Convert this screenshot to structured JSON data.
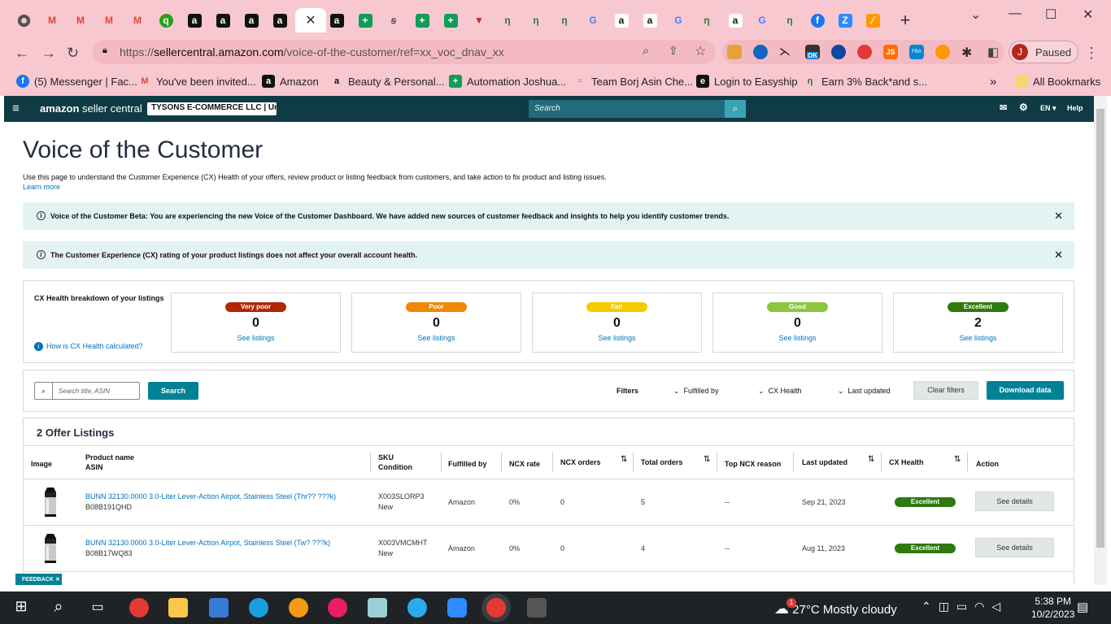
{
  "browser": {
    "url_prefix": "https://",
    "url_domain": "sellercentral.amazon.com",
    "url_path": "/voice-of-the-customer/ref=xx_voc_dnav_xx",
    "profile_initial": "J",
    "profile_status": "Paused",
    "ext_badge": "OK",
    "ext_js": "JS",
    "ext_fba": "FBA",
    "bookmarks": [
      {
        "label": "(5) Messenger | Fac...",
        "icon": "messenger-icon",
        "color": "#1877f2",
        "glyph": "f"
      },
      {
        "label": "You've been invited...",
        "icon": "gmail-icon",
        "color": "#ea4335",
        "glyph": "M"
      },
      {
        "label": "Amazon",
        "icon": "amazon-icon",
        "color": "#111111",
        "glyph": "a"
      },
      {
        "label": "Beauty & Personal...",
        "icon": "amazon-icon",
        "color": "#ffffff",
        "glyph": "a"
      },
      {
        "label": "Automation Joshua...",
        "icon": "sheets-icon",
        "color": "#0f9d58",
        "glyph": "+"
      },
      {
        "label": "Team Borj Asin Che...",
        "icon": "team-icon",
        "color": "#aaaaaa",
        "glyph": "≈"
      },
      {
        "label": "Login to Easyship",
        "icon": "easyship-icon",
        "color": "#111111",
        "glyph": "e"
      },
      {
        "label": "Earn 3% Back*and s...",
        "icon": "cashback-icon",
        "color": "#2e7d32",
        "glyph": "/"
      }
    ],
    "bookmarks_more": "»",
    "all_bookmarks": "All Bookmarks"
  },
  "header": {
    "logo_brand": "amazon",
    "logo_suffix": " seller central",
    "account": "TYSONS E-COMMERCE LLC | Uni...",
    "search_placeholder": "Search",
    "lang": "EN",
    "help": "Help"
  },
  "page": {
    "title": "Voice of the Customer",
    "description": "Use this page to understand the Customer Experience (CX) Health of your offers, review product or listing feedback from customers, and take action to fix product and listing issues.",
    "learn_more": "Learn more",
    "banner1": "Voice of the Customer Beta: You are experiencing the new Voice of the Customer Dashboard. We have added new sources of customer feedback and insights to help you identify customer trends.",
    "banner2": "The Customer Experience (CX) rating of your product listings does not affect your overall account health.",
    "cx_label": "CX Health breakdown of your listings",
    "cx_how": "How is CX Health calculated?",
    "cx_boxes": [
      {
        "label": "Very poor",
        "count": "0",
        "link": "See listings",
        "color": "#b12704"
      },
      {
        "label": "Poor",
        "count": "0",
        "link": "See listings",
        "color": "#f08804"
      },
      {
        "label": "Fair",
        "count": "0",
        "link": "See listings",
        "color": "#f7ca00"
      },
      {
        "label": "Good",
        "count": "0",
        "link": "See listings",
        "color": "#8cc63f"
      },
      {
        "label": "Excellent",
        "count": "2",
        "link": "See listings",
        "color": "#2f7a0f"
      }
    ],
    "search_placeholder": "Search title, ASIN",
    "search_button": "Search",
    "filters_label": "Filters",
    "filter_fulfilled": "Fulfilled by",
    "filter_cx": "CX Health",
    "filter_updated": "Last updated",
    "clear_filters": "Clear filters",
    "download": "Download data",
    "table_title": "2 Offer Listings",
    "columns": {
      "image": "Image",
      "product": "Product name",
      "asin": "ASIN",
      "sku": "SKU",
      "condition": "Condition",
      "fulfilled": "Fulfilled by",
      "ncx_rate": "NCX rate",
      "ncx_orders": "NCX orders",
      "total_orders": "Total orders",
      "top_reason": "Top NCX reason",
      "last_updated": "Last updated",
      "cx_health": "CX Health",
      "action": "Action"
    },
    "rows": [
      {
        "name": "BUNN 32130.0000 3.0-Liter Lever-Action Airpot, Stainless Steel (Thr?? ???k)",
        "asin": "B08B191QHD",
        "sku": "X003SLORP3",
        "condition": "New",
        "fulfilled": "Amazon",
        "ncx_rate": "0%",
        "ncx_orders": "0",
        "total_orders": "5",
        "reason": "--",
        "updated": "Sep 21, 2023",
        "health": "Excellent",
        "action": "See details"
      },
      {
        "name": "BUNN 32130.0000 3.0-Liter Lever-Action Airpot, Stainless Steel (Tw? ???k)",
        "asin": "B08B17WQ83",
        "sku": "X003VMCMHT",
        "condition": "New",
        "fulfilled": "Amazon",
        "ncx_rate": "0%",
        "ncx_orders": "0",
        "total_orders": "4",
        "reason": "--",
        "updated": "Aug 11, 2023",
        "health": "Excellent",
        "action": "See details"
      }
    ],
    "feedback": "FEEDBACK ✕"
  },
  "taskbar": {
    "weather": "27°C  Mostly cloudy",
    "weather_badge": "1",
    "time": "5:38 PM",
    "date": "10/2/2023"
  }
}
